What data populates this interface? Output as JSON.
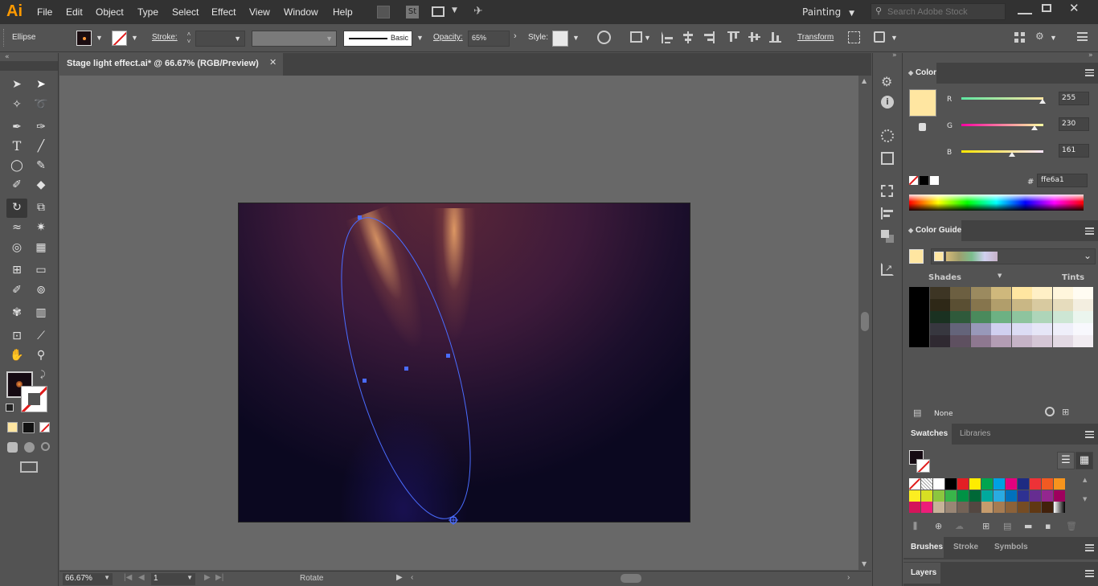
{
  "app": {
    "logo": "Ai"
  },
  "menu": [
    "File",
    "Edit",
    "Object",
    "Type",
    "Select",
    "Effect",
    "View",
    "Window",
    "Help"
  ],
  "workspace": {
    "label": "Painting"
  },
  "search": {
    "placeholder": "Search Adobe Stock"
  },
  "control": {
    "selection_label": "Ellipse",
    "stroke_label": "Stroke:",
    "brush_label": "Basic",
    "opacity_label": "Opacity:",
    "opacity_value": "65%",
    "style_label": "Style:",
    "transform_label": "Transform"
  },
  "document": {
    "tab_title": "Stage light effect.ai* @ 66.67% (RGB/Preview)"
  },
  "status": {
    "zoom": "66.67%",
    "artboard": "1",
    "tool": "Rotate"
  },
  "color_panel": {
    "title": "Color",
    "r_label": "R",
    "r_value": "255",
    "g_label": "G",
    "g_value": "230",
    "b_label": "B",
    "b_value": "161",
    "hex_prefix": "#",
    "hex_value": "ffe6a1",
    "swatch_color": "#ffe6a1"
  },
  "color_guide": {
    "title": "Color Guide",
    "shades_label": "Shades",
    "tints_label": "Tints",
    "none_label": "None"
  },
  "swatches_panel": {
    "tab_swatches": "Swatches",
    "tab_libraries": "Libraries"
  },
  "bottom_tabs": {
    "brushes": "Brushes",
    "stroke": "Stroke",
    "symbols": "Symbols",
    "layers": "Layers"
  },
  "colors": {
    "accent": "#4a6cff",
    "panel_bg": "#535353",
    "canvas_bg": "#686868"
  }
}
